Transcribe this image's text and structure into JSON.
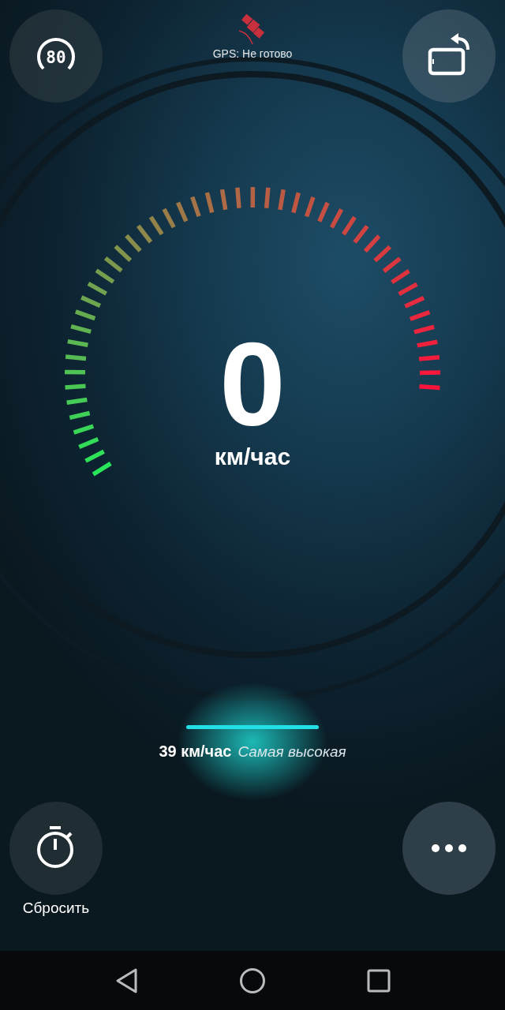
{
  "speed_limit_button": {
    "label": "80"
  },
  "gps_status": {
    "label": "GPS: Не готово",
    "ready": false
  },
  "speed": {
    "value": "0",
    "unit": "км/час"
  },
  "max_speed": {
    "value": "39 км/час",
    "label": "Самая высокая"
  },
  "reset_button": {
    "label": "Сбросить"
  }
}
